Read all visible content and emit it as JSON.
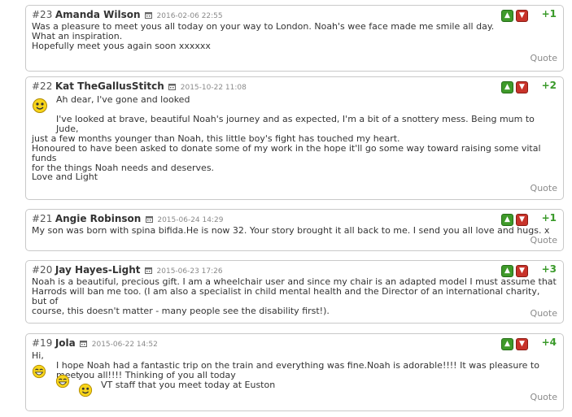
{
  "quote_label": "Quote",
  "colors": {
    "vote_up": "#3f9a2a",
    "vote_down": "#c8332a",
    "score": "#3a9a2a"
  },
  "comments": [
    {
      "number": "#23",
      "author": "Amanda Wilson",
      "date": "2016-02-06 22:55",
      "score": "+1",
      "lines": [
        "Was a pleasure to meet yous all today on your way to London. Noah's wee face made me smile all day.",
        "What an inspiration.",
        "Hopefully meet yous again soon xxxxxx"
      ]
    },
    {
      "number": "#22",
      "author": "Kat TheGallusStitch",
      "date": "2015-10-22 11:08",
      "score": "+2",
      "lines": [
        "Ah dear, I've gone and looked",
        "I've looked at brave, beautiful Noah's journey and as expected, I'm a bit of a snottery mess. Being mum to Jude,",
        "just a few months younger than Noah, this little boy's fight has touched my heart.",
        "Honoured to have been asked to donate some of my work in the hope it'll go some way toward raising some vital funds",
        "for the things Noah needs and deserves.",
        "Love and Light"
      ]
    },
    {
      "number": "#21",
      "author": "Angie Robinson",
      "date": "2015-06-24 14:29",
      "score": "+1",
      "lines": [
        "My son was born with spina bifida.He is now 32. Your story brought it all back to me. I send you all love and hugs. x"
      ]
    },
    {
      "number": "#20",
      "author": "Jay Hayes-Light",
      "date": "2015-06-23 17:26",
      "score": "+3",
      "lines": [
        "Noah is a beautiful, precious gift. I am a wheelchair user and since my chair is an adapted model I must assume that",
        "Harrods will ban me too. (I am also a specialist in child mental health and the Director of an international charity, but of",
        "course, this doesn't matter - many people see the disability first!)."
      ]
    },
    {
      "number": "#19",
      "author": "Jola",
      "date": "2015-06-22 14:52",
      "score": "+4",
      "lines": [
        "Hi,",
        "I hope Noah had a fantastic trip on the train and everything was fine.Noah is adorable!!!! It was pleasure to meet",
        "you all!!!! Thinking of you all today",
        "VT staff that you meet today at Euston"
      ]
    }
  ]
}
